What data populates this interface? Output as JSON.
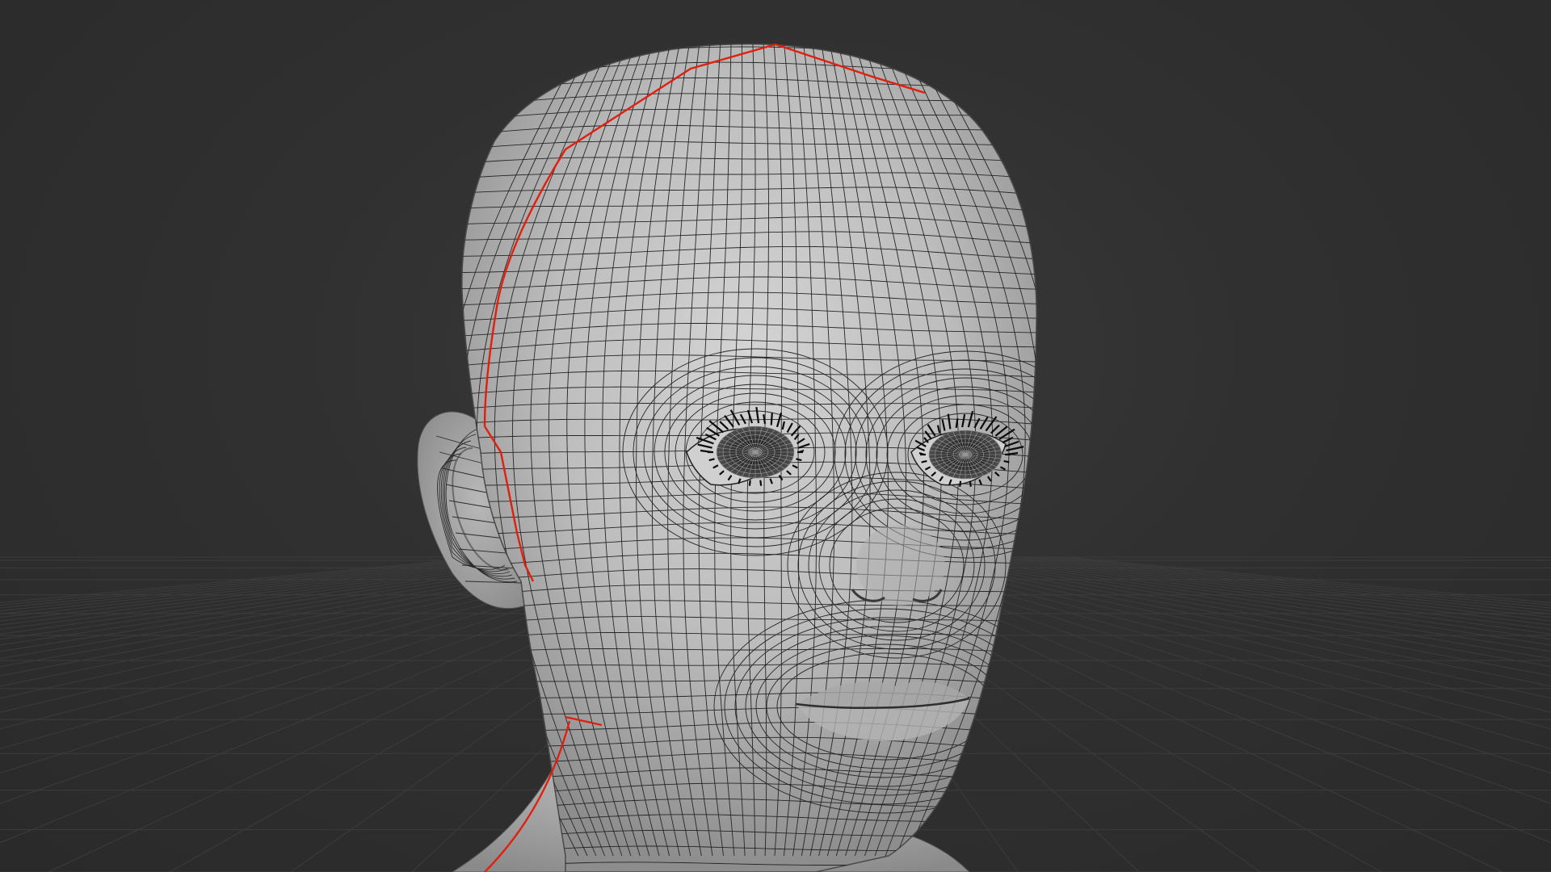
{
  "viewport": {
    "mode": "edit-mesh-wireframe",
    "background_color": "#2c2c2c",
    "grid_color": "#3d3d3d",
    "mesh_color": "#c8c8c8",
    "wire_color": "#1e1e1e",
    "seam_color": "#e02010",
    "object": "head-mesh",
    "icons": {
      "object": "head-mesh-icon"
    }
  }
}
